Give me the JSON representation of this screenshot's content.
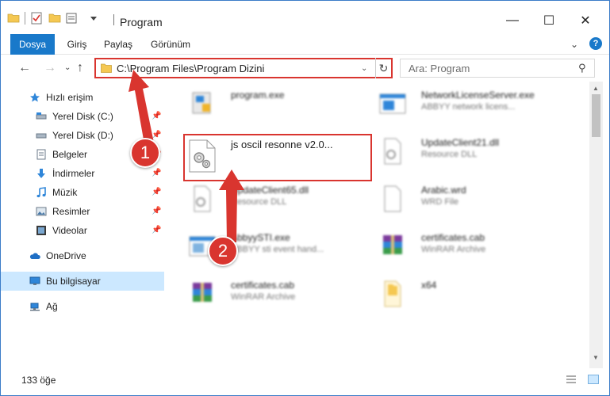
{
  "window": {
    "title": "Program"
  },
  "ribbon": {
    "tabs": [
      "Dosya",
      "Giriş",
      "Paylaş",
      "Görünüm"
    ]
  },
  "address_bar": {
    "path": "C:\\Program Files\\Program Dizini"
  },
  "search": {
    "placeholder": "Ara: Program"
  },
  "sidebar": {
    "items": [
      {
        "label": "Hızlı erişim",
        "icon": "star-icon",
        "pinned": false
      },
      {
        "label": "Yerel Disk (C:)",
        "icon": "drive-icon",
        "pinned": true
      },
      {
        "label": "Yerel Disk (D:)",
        "icon": "drive-icon",
        "pinned": true
      },
      {
        "label": "Belgeler",
        "icon": "documents-icon",
        "pinned": true
      },
      {
        "label": "İndirmeler",
        "icon": "download-icon",
        "pinned": true
      },
      {
        "label": "Müzik",
        "icon": "music-icon",
        "pinned": true
      },
      {
        "label": "Resimler",
        "icon": "pictures-icon",
        "pinned": true
      },
      {
        "label": "Videolar",
        "icon": "video-icon",
        "pinned": true
      },
      {
        "label": "OneDrive",
        "icon": "cloud-icon",
        "pinned": false
      },
      {
        "label": "Bu bilgisayar",
        "icon": "computer-icon",
        "pinned": false
      },
      {
        "label": "Ağ",
        "icon": "network-icon",
        "pinned": false
      }
    ]
  },
  "files": {
    "highlighted": {
      "name": "js oscil resonne v2.0..."
    },
    "items": [
      {
        "name": "program.exe",
        "desc": "",
        "icon": "exe-icon"
      },
      {
        "name": "NetworkLicenseServer.exe",
        "desc": "ABBYY network licens...",
        "icon": "exe-icon"
      },
      {
        "name": "UpdateClient21.dll",
        "desc": "Resource DLL",
        "icon": "dll-icon"
      },
      {
        "name": "UpdateClient65.dll",
        "desc": "Resource DLL",
        "icon": "dll-icon"
      },
      {
        "name": "Arabic.wrd",
        "desc": "WRD File",
        "icon": "file-icon"
      },
      {
        "name": "AbbyySTI.exe",
        "desc": "ABBYY sti event hand...",
        "icon": "exe-icon"
      },
      {
        "name": "certificates.cab",
        "desc": "WinRAR Archive",
        "icon": "archive-icon"
      },
      {
        "name": "certificates.cab",
        "desc": "WinRAR Archive",
        "icon": "archive-icon"
      },
      {
        "name": "x64",
        "desc": "",
        "icon": "folder-icon"
      }
    ]
  },
  "status": {
    "count": "133 öğe"
  },
  "annotations": {
    "badge1": "1",
    "badge2": "2"
  }
}
